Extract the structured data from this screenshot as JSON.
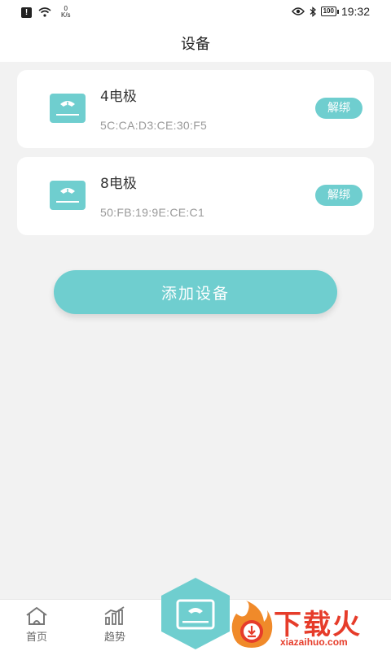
{
  "status_bar": {
    "net_speed_value": "0",
    "net_speed_unit": "K/s",
    "battery": "100",
    "time": "19:32"
  },
  "header": {
    "title": "设备"
  },
  "devices": [
    {
      "name": "4电极",
      "mac": "5C:CA:D3:CE:30:F5",
      "unbind_label": "解绑"
    },
    {
      "name": "8电极",
      "mac": "50:FB:19:9E:CE:C1",
      "unbind_label": "解绑"
    }
  ],
  "add_button": {
    "label": "添加设备"
  },
  "tab_bar": {
    "items": [
      {
        "label": "首页",
        "icon": "home-icon"
      },
      {
        "label": "趋势",
        "icon": "trend-chart-icon"
      },
      {
        "label": "",
        "icon": "scale-device-icon"
      }
    ]
  },
  "watermark": {
    "brand": "下载火",
    "site": "xiazaihuo.com"
  },
  "colors": {
    "accent": "#6fcecf",
    "background": "#f2f2f2",
    "card": "#ffffff",
    "watermark": "#e63c2a"
  }
}
